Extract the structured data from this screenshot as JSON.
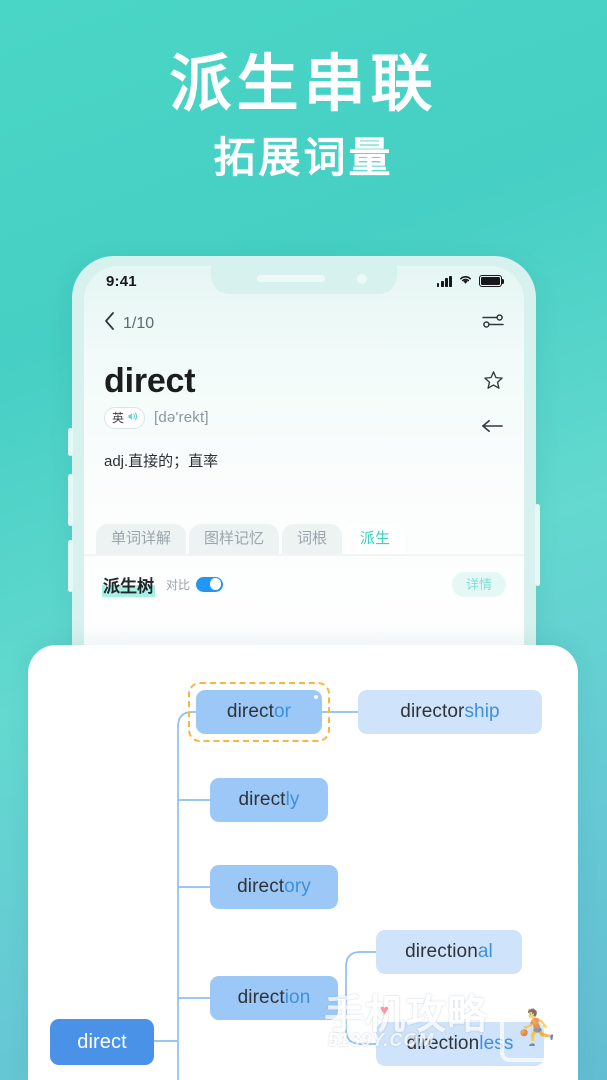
{
  "hero": {
    "title": "派生串联",
    "subtitle": "拓展词量"
  },
  "colors": {
    "background_start": "#4ad6c6",
    "background_end": "#63bdd2",
    "accent_teal": "#3fd0c0",
    "node_mid": "#9cc8f7",
    "node_pale": "#cfe3fb",
    "node_root": "#4a92e8",
    "suffix_blue": "#3d90e0",
    "selection_dashed": "#f5b73c",
    "toggle_on": "#2196f3",
    "highlight_mint": "#a9f0e4"
  },
  "phone": {
    "status_bar": {
      "time": "9:41",
      "signal_icon": "cellular-signal-icon",
      "wifi_icon": "wifi-icon",
      "battery_icon": "battery-full-icon"
    },
    "nav_bar": {
      "back_icon": "chevron-left-icon",
      "counter": "1/10",
      "settings_icon": "sliders-icon"
    },
    "word_card": {
      "word": "direct",
      "accent_label": "英",
      "speaker_icon": "speaker-wave-icon",
      "phonetic": "[də'rekt]",
      "definition": "adj.直接的；直率",
      "star_icon": "star-outline-icon",
      "arrow_icon": "arrow-left-icon"
    },
    "tabs": [
      {
        "label": "单词详解",
        "active": false
      },
      {
        "label": "图样记忆",
        "active": false
      },
      {
        "label": "词根",
        "active": false
      },
      {
        "label": "派生",
        "active": true
      }
    ],
    "tree_header": {
      "title": "派生树",
      "compare_label": "对比",
      "compare_on": true,
      "detail_button": "详情"
    }
  },
  "derivation_tree": {
    "root": {
      "base": "direct",
      "suffix": ""
    },
    "nodes": [
      {
        "id": "director",
        "base": "direct",
        "suffix": "or",
        "style": "mid",
        "selected": true
      },
      {
        "id": "directorship",
        "base": "director",
        "suffix": "ship",
        "style": "pale",
        "selected": false
      },
      {
        "id": "directly",
        "base": "direct",
        "suffix": "ly",
        "style": "mid",
        "selected": false
      },
      {
        "id": "directory",
        "base": "direct",
        "suffix": "ory",
        "style": "mid",
        "selected": false
      },
      {
        "id": "direction",
        "base": "direct",
        "suffix": "ion",
        "style": "mid",
        "selected": false
      },
      {
        "id": "directional",
        "base": "direction",
        "suffix": "al",
        "style": "pale",
        "selected": false
      },
      {
        "id": "directionless",
        "base": "direction",
        "suffix": "less",
        "style": "pale",
        "selected": false
      }
    ]
  },
  "watermark": {
    "main": "手机攻略",
    "sub": "5139Y.COM",
    "heart_icon": "heart-icon",
    "badge_icon": "app-badge-icon"
  }
}
